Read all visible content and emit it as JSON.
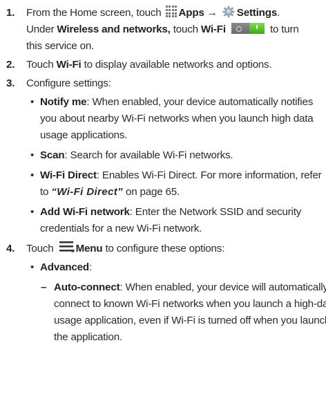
{
  "steps": [
    {
      "number": "1.",
      "lead": "From the Home screen, touch",
      "apps_label": "Apps",
      "arrow": "→",
      "settings_label": "Settings",
      "settings_suffix": ".",
      "under_text": "Under",
      "wireless_label": "Wireless and networks,",
      "touch_text": "touch",
      "wifi_label": "Wi-Fi",
      "turn_on_text": "to turn",
      "service_text": "this service on."
    },
    {
      "number": "2.",
      "touch_text": "Touch",
      "wifi_label": "Wi-Fi",
      "rest_text": "to display available networks and options."
    },
    {
      "number": "3.",
      "text": "Configure settings:",
      "bullets": [
        {
          "label": "Notify me",
          "text_lines": [
            ": When enabled, your device automatically notifies",
            "you about nearby Wi-Fi networks when you launch high data",
            "usage applications."
          ]
        },
        {
          "label": "Scan",
          "text_lines": [
            ": Search for available Wi-Fi networks."
          ]
        },
        {
          "label": "Wi-Fi Direct",
          "text_lines": [
            ": Enables Wi-Fi Direct. For more information, refer"
          ],
          "ref_prefix": "to",
          "ref_title": "“Wi-Fi Direct”",
          "ref_suffix": "on page 65."
        },
        {
          "label": "Add Wi-Fi network",
          "text_lines": [
            ": Enter the Network SSID and security",
            "credentials for a new Wi-Fi network."
          ]
        }
      ]
    },
    {
      "number": "4.",
      "touch_text": "Touch",
      "menu_label": "Menu",
      "rest_text": "to configure these options:",
      "bullets": [
        {
          "label": "Advanced",
          "suffix": ":",
          "sub": {
            "dash": "–",
            "label": "Auto-connect",
            "text_lines": [
              ": When enabled, your device will automatically",
              "connect to known Wi-Fi networks when you launch a high-data-",
              "usage application, even if Wi-Fi is turned off when you launch",
              "the application."
            ]
          }
        }
      ]
    }
  ],
  "icons": {
    "apps": "apps-grid-icon",
    "settings": "gear-icon",
    "wifi_toggle": "toggle-switch-icon",
    "menu": "menu-icon"
  },
  "colors": {
    "text": "#2b2b2b",
    "toggle_on": "#4cbf2a",
    "toggle_off": "#7a7a7a",
    "settings_icon": "#6fb3d9"
  }
}
